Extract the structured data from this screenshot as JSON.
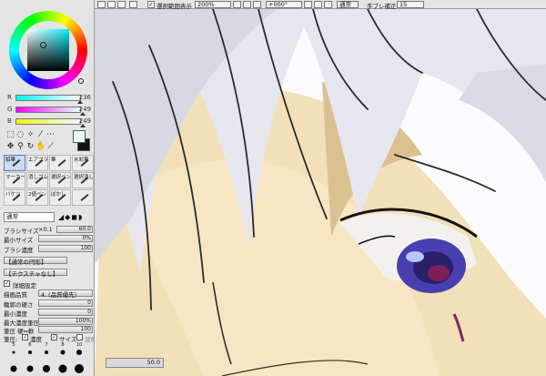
{
  "color": {
    "r": {
      "label": "R",
      "value": "236"
    },
    "g": {
      "label": "G",
      "value": "249"
    },
    "b": {
      "label": "B",
      "value": "249"
    }
  },
  "brushes": [
    {
      "label": "鉛筆",
      "selected": true
    },
    {
      "label": "エアブラシ"
    },
    {
      "label": "筆"
    },
    {
      "label": "水彩筆"
    },
    {
      "label": "マーカー"
    },
    {
      "label": "消しゴム"
    },
    {
      "label": "選択ペン"
    },
    {
      "label": "選択消し"
    },
    {
      "label": "バケツ"
    },
    {
      "label": "2値ペン"
    },
    {
      "label": "ぼかし"
    },
    {
      "label": ""
    }
  ],
  "blend": {
    "mode": "通常"
  },
  "props": {
    "brush_size_label": "ブラシサイズ",
    "brush_size_mult": "×0.1",
    "brush_size": "60.0",
    "min_size_label": "最小サイズ",
    "min_size": "0%",
    "density_label": "ブラシ濃度",
    "density": "100",
    "shape": "【通常の円形】",
    "texture": "【テクスチャなし】",
    "advanced_label": "詳細設定",
    "quality_label": "描画品質",
    "quality": "4（品質優先）",
    "edge_label": "輪郭の硬さ",
    "edge": "0",
    "min_density_label": "最小濃度",
    "min_density": "0",
    "max_pressure_label": "最大濃度筆圧",
    "max_pressure": "100%",
    "pressure_hard_label": "筆圧 硬⇔軟",
    "pressure_hard": "100",
    "pressure_label": "筆圧:",
    "pressure_density": "濃度",
    "pressure_size": "サイズ",
    "pressure_blend": "混色"
  },
  "brush_dots": [
    {
      "n": "5",
      "d": 0.28
    },
    {
      "n": "6",
      "d": 0.32
    },
    {
      "n": "7",
      "d": 0.36
    },
    {
      "n": "8",
      "d": 0.42
    },
    {
      "n": "10",
      "d": 0.5
    },
    {
      "n": "",
      "d": 0.55
    },
    {
      "n": "",
      "d": 0.6
    },
    {
      "n": "",
      "d": 0.65
    },
    {
      "n": "",
      "d": 0.72
    },
    {
      "n": "",
      "d": 0.8
    }
  ],
  "toolbar": {
    "show_selection": "選択範囲表示",
    "zoom": "200%",
    "rotation": "+000°",
    "mode": "通常",
    "stabilizer_label": "手ブレ補正",
    "stabilizer": "15"
  },
  "status": {
    "value": "50.0"
  }
}
